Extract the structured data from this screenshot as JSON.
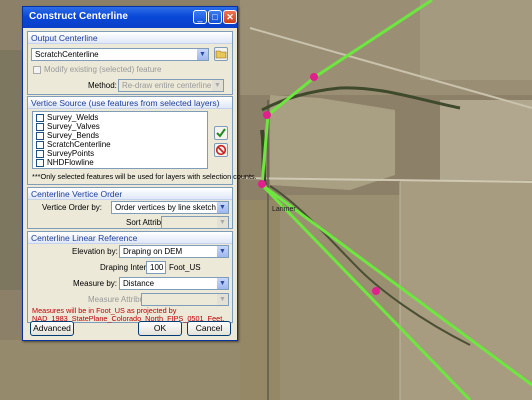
{
  "dialog": {
    "title": "Construct Centerline",
    "output_centerline": {
      "header": "Output Centerline",
      "layer_value": "ScratchCenterline",
      "modify_existing_label": "Modify existing (selected) feature",
      "method_label": "Method:",
      "method_value": "Re-draw entire centerline"
    },
    "vertice_source": {
      "header": "Vertice Source (use features from selected layers)",
      "layers": [
        "Survey_Welds",
        "Survey_Valves",
        "Survey_Bends",
        "ScratchCenterline",
        "SurveyPoints",
        "NHDFlowline"
      ],
      "note": "***Only selected features will be used for layers with selection counts."
    },
    "vertice_order": {
      "header": "Centerline Vertice Order",
      "order_label": "Vertice Order by:",
      "order_value": "Order vertices by line sketch",
      "sort_label": "Sort Attribute:",
      "sort_value": ""
    },
    "linear_reference": {
      "header": "Centerline Linear Reference",
      "elevation_label": "Elevation by:",
      "elevation_value": "Draping on DEM",
      "interval_label": "Draping Interval",
      "interval_value": "100",
      "interval_unit": "Foot_US",
      "measure_label": "Measure by:",
      "measure_value": "Distance",
      "measure_attr_label": "Measure Attribute:",
      "measure_attr_value": "",
      "message_line1": "Measures will be in Foot_US as projected by",
      "message_line2": "NAD_1983_StatePlane_Colorado_North_FIPS_0501_Feet."
    },
    "buttons": {
      "advanced": "Advanced",
      "ok": "OK",
      "cancel": "Cancel"
    }
  },
  "map": {
    "place_label": "Larimer",
    "line_color": "#6ee640",
    "vertex_color": "#e0208c"
  }
}
